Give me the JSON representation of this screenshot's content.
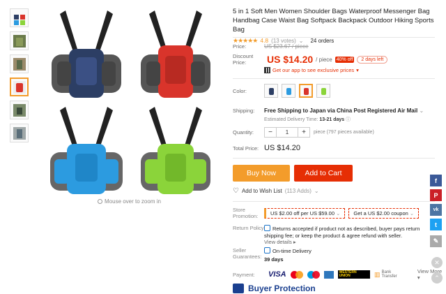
{
  "product": {
    "title": "5 in 1 Soft Men Women Shoulder Bags Waterproof Messenger Bag Handbag Case Waist Bag Softpack Backpack Outdoor Hiking Sports Bag",
    "stars": "★★★★★",
    "rating": "4.8",
    "votes": "(13 votes)",
    "orders": "24 orders"
  },
  "gallery": {
    "zoom_hint": "Mouse over to zoom in",
    "thumb_colors": [
      "#2c3e64",
      "#4b5e2a",
      "#7a6b4a",
      "#d9342b",
      "#4a5a3a",
      "#5b6f7a"
    ]
  },
  "price": {
    "label": "Price:",
    "original": "US $23.67 / piece",
    "discount_label": "Discount Price:",
    "current": "US $14.20",
    "unit": "/ piece",
    "off_badge": "40% off",
    "days_left": "2 days left",
    "app_promo": "Get our app to see exclusive prices"
  },
  "color": {
    "label": "Color:",
    "options": [
      "navy",
      "blue",
      "red",
      "green"
    ],
    "selected_index": 2
  },
  "shipping": {
    "label": "Shipping:",
    "text": "Free Shipping to Japan via China Post Registered Air Mail",
    "delivery_label": "Estimated Delivery Time:",
    "delivery_days": "13-21 days"
  },
  "quantity": {
    "label": "Quantity:",
    "value": "1",
    "available": "piece (797 pieces available)"
  },
  "total": {
    "label": "Total Price:",
    "value": "US $14.20"
  },
  "actions": {
    "buy_now": "Buy Now",
    "add_to_cart": "Add to Cart",
    "wishlist": "Add to Wish List",
    "wishlist_count": "(113 Adds)"
  },
  "promotion": {
    "label": "Store Promotion:",
    "coupon1": "US $2.00 off per US $59.00",
    "coupon2": "Get a US $2.00 coupon"
  },
  "return_policy": {
    "label": "Return Policy",
    "text": "Returns accepted if product not as described, buyer pays return shipping fee; or keep the product & agree refund with seller.",
    "details": "View details"
  },
  "guarantees": {
    "label": "Seller Guarantees:",
    "item": "On-time Delivery",
    "days": "39 days"
  },
  "payment": {
    "label": "Payment:",
    "visa": "VISA",
    "wu": "WESTERN UNION",
    "bank": "Bank Transfer",
    "view_more": "View More"
  },
  "buyer_protection": "Buyer Protection",
  "social": {
    "facebook": "f",
    "pinterest": "P",
    "vk": "vk",
    "twitter": "t",
    "edit": "✎"
  },
  "colors": {
    "accent": "#f39c2b",
    "price_red": "#e62e04",
    "brand_blue": "#1a3f8f"
  }
}
